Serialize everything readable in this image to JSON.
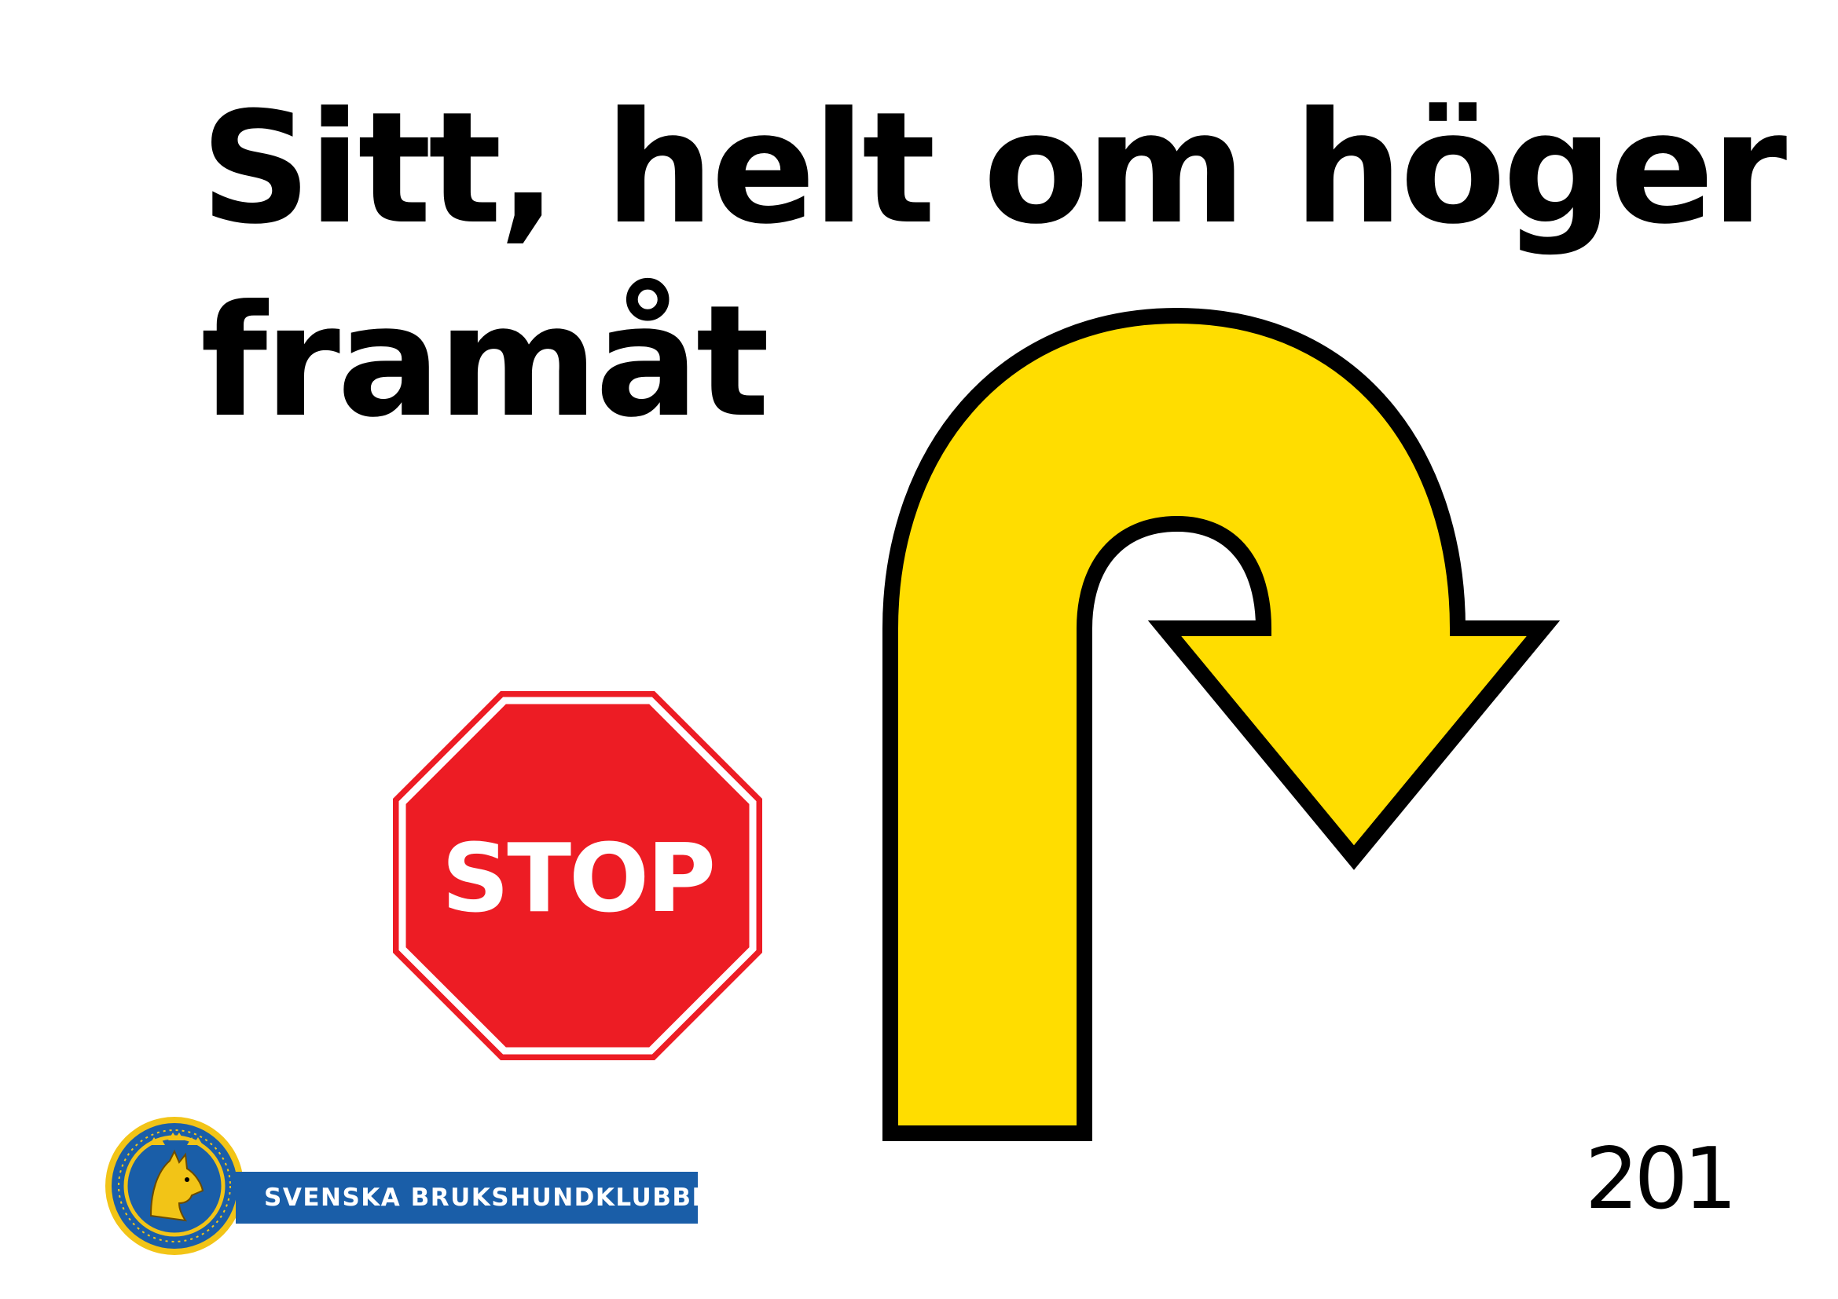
{
  "sign": {
    "title_line_1": "Sitt, helt om höger",
    "title_line_2": "framåt",
    "number": "201",
    "direction_icon": "u-turn-right-arrow-icon",
    "arrow_color": "#ffdd00",
    "stop_sign": {
      "text": "STOP",
      "color": "#ed1c24"
    }
  },
  "club": {
    "name": "SVENSKA BRUKSHUNDKLUBBEN",
    "logo_icon": "dog-seal-icon",
    "band_color": "#1a5ea8",
    "seal_colors": {
      "ring": "#1a5ea8",
      "gold": "#f2c417"
    }
  }
}
